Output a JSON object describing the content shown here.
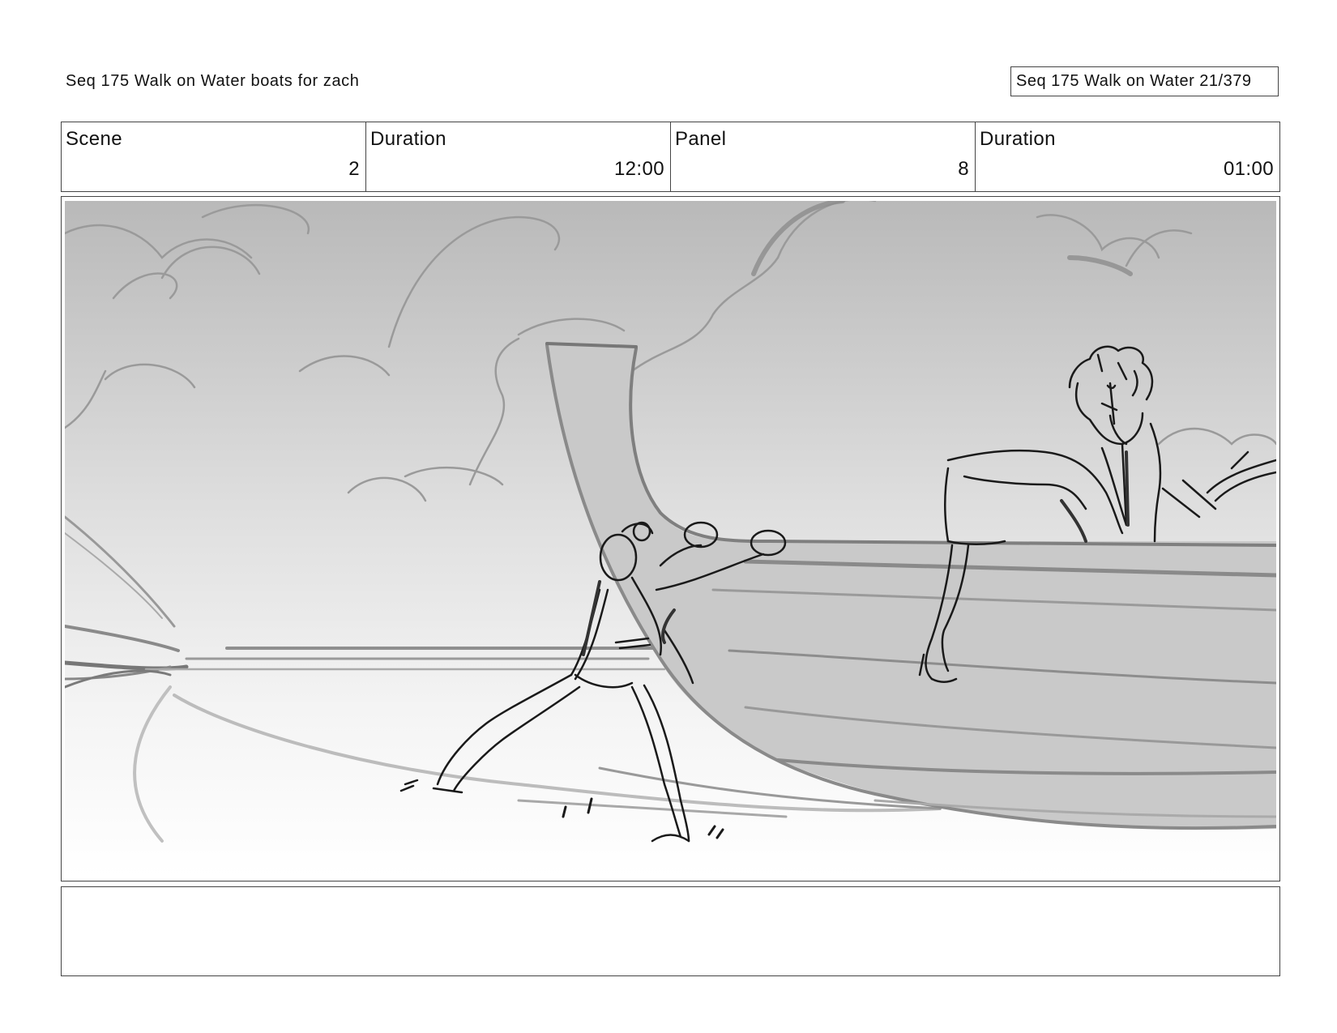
{
  "header": {
    "sequence_title": "Seq 175 Walk on Water  boats for zach",
    "page_indicator": "Seq 175 Walk on Water  21/379"
  },
  "info": {
    "scene_label": "Scene",
    "scene_value": "2",
    "scene_duration_label": "Duration",
    "scene_duration_value": "12:00",
    "panel_label": "Panel",
    "panel_value": "8",
    "panel_duration_label": "Duration",
    "panel_duration_value": "01:00"
  },
  "notes": {
    "text": ""
  }
}
